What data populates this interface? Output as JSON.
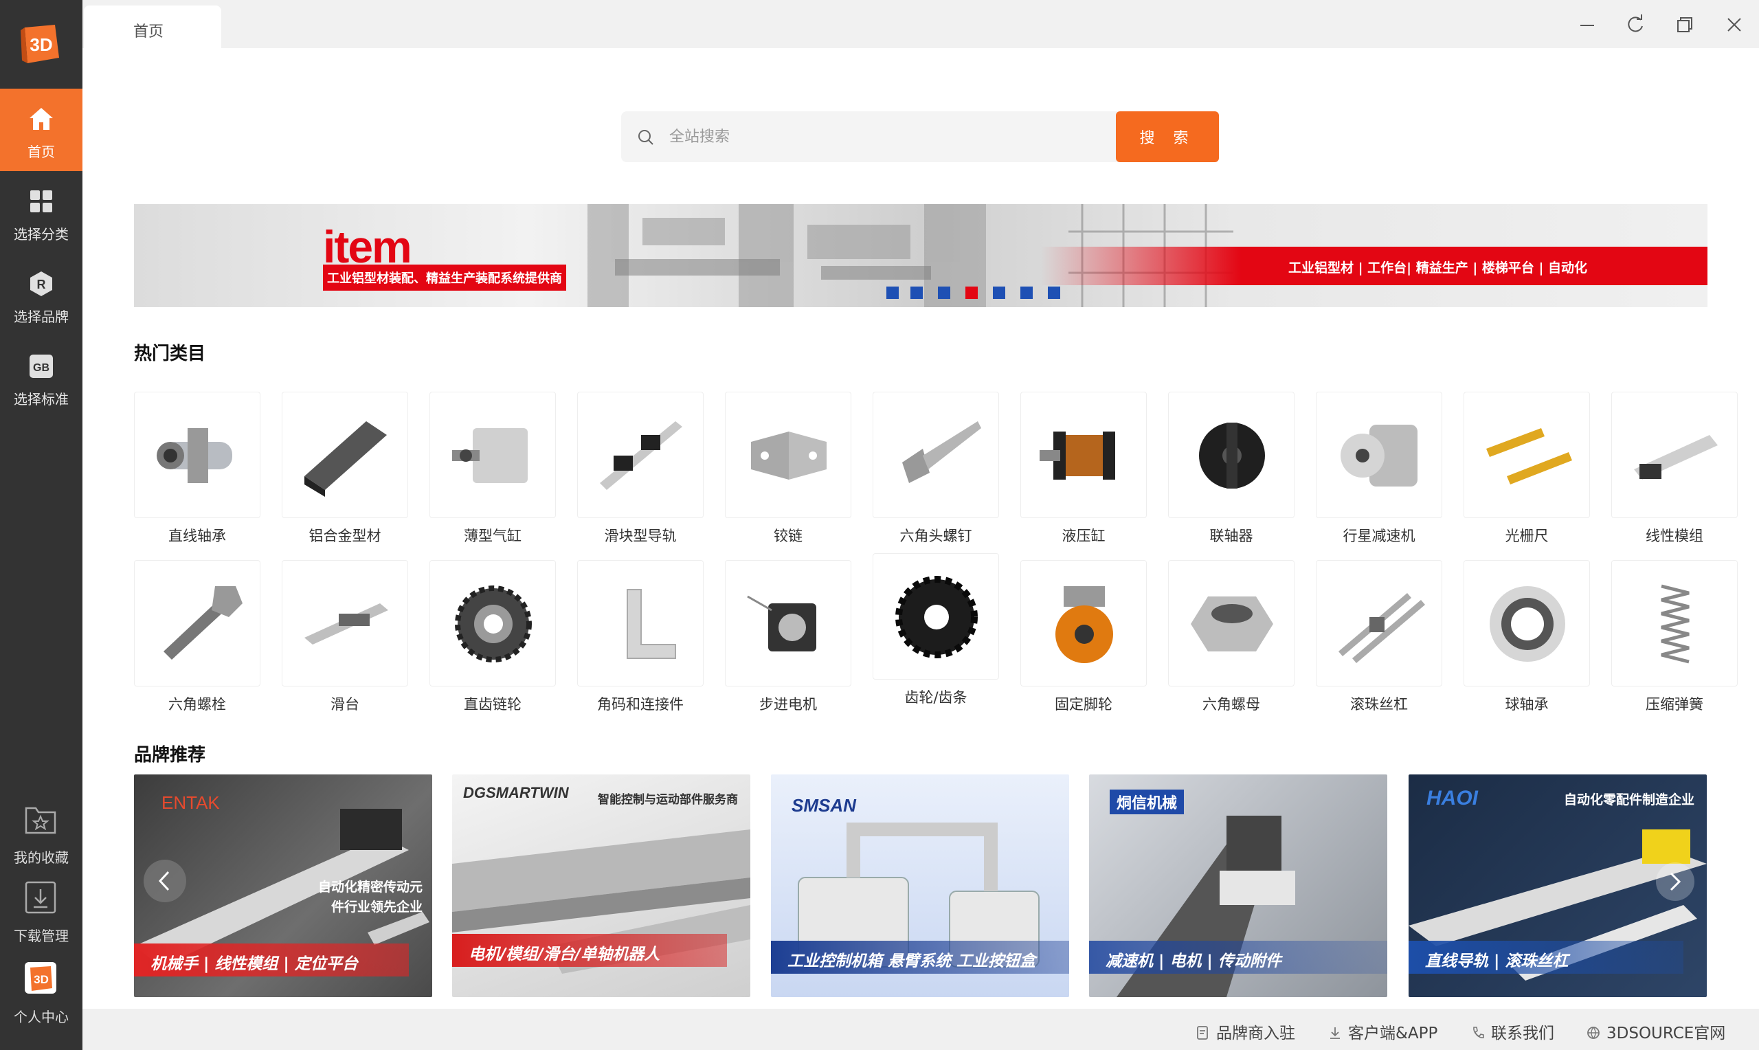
{
  "app": {
    "logo_text": "3D"
  },
  "sidebar": {
    "items": [
      {
        "label": "首页",
        "icon": "home-icon"
      },
      {
        "label": "选择分类",
        "icon": "grid-icon"
      },
      {
        "label": "选择品牌",
        "icon": "brand-r-icon"
      },
      {
        "label": "选择标准",
        "icon": "standard-gb-icon"
      }
    ],
    "favorites_label": "我的收藏",
    "downloads_label": "下载管理",
    "profile_label": "个人中心"
  },
  "topbar": {
    "tab_label": "首页"
  },
  "search": {
    "placeholder": "全站搜索",
    "value": "",
    "button_label": "搜 索"
  },
  "banner": {
    "brand": "item",
    "subtitle": "工业铝型材装配、精益生产装配系统提供商",
    "tagline": "工业铝型材 | 工作台| 精益生产 | 楼梯平台 | 自动化"
  },
  "hot_categories": {
    "title": "热门类目",
    "row1": [
      "直线轴承",
      "铝合金型材",
      "薄型气缸",
      "滑块型导轨",
      "铰链",
      "六角头螺钉",
      "液压缸",
      "联轴器",
      "行星减速机",
      "光栅尺",
      "线性模组"
    ],
    "row2": [
      "六角螺栓",
      "滑台",
      "直齿链轮",
      "角码和连接件",
      "步进电机",
      "齿轮/齿条",
      "固定脚轮",
      "六角螺母",
      "滚珠丝杠",
      "球轴承",
      "压缩弹簧"
    ]
  },
  "brands": {
    "title": "品牌推荐",
    "cards": [
      {
        "name": "ENTAK",
        "tag": "",
        "slogan": "自动化精密传动元件行业领先企业",
        "strip": "机械手 | 线性模组 | 定位平台"
      },
      {
        "name": "DGSMARTWIN",
        "tag": "智能控制与运动部件服务商",
        "slogan": "",
        "strip": "电机/模组/滑台/单轴机器人"
      },
      {
        "name": "SMSAN",
        "tag": "",
        "slogan": "",
        "strip": "工业控制机箱 悬臂系统 工业按钮盒"
      },
      {
        "name": "烔信机械",
        "tag": "",
        "slogan": "",
        "strip": "减速机 | 电机 | 传动附件"
      },
      {
        "name": "HAOI",
        "tag": "自动化零配件制造企业",
        "slogan": "",
        "strip": "直线导轨 | 滚珠丝杠"
      }
    ]
  },
  "footer": {
    "links": [
      "品牌商入驻",
      "客户端&APP",
      "联系我们",
      "3DSOURCE官网"
    ]
  },
  "colors": {
    "accent": "#f3722c",
    "sidebar_bg": "#333333",
    "banner_red": "#e30613"
  }
}
